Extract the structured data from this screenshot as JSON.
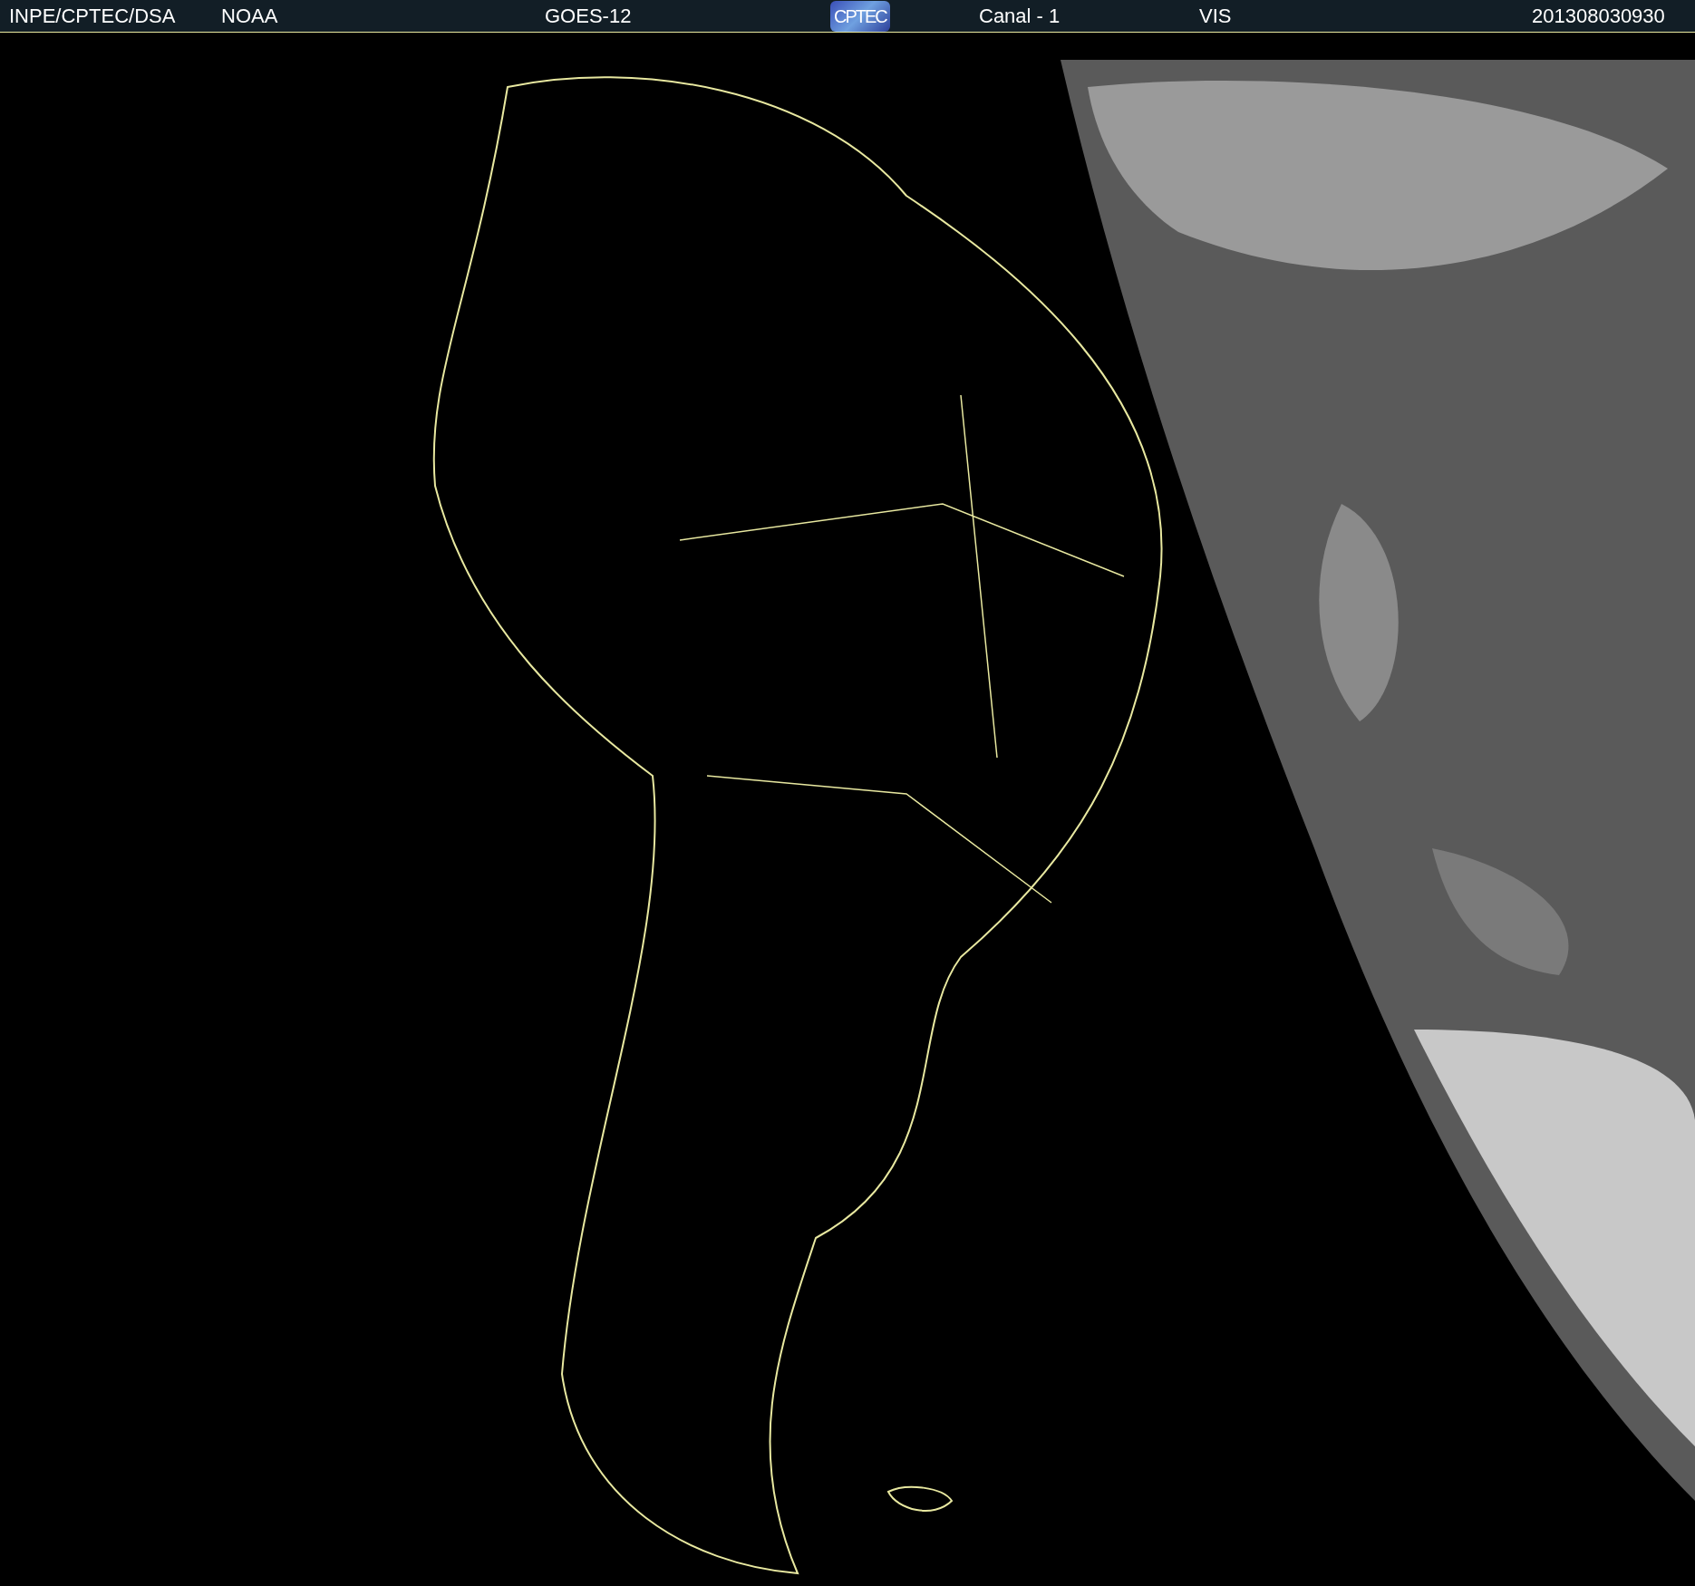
{
  "header": {
    "items": [
      {
        "kind": "text",
        "text": "INPE/CPTEC/DSA"
      },
      {
        "kind": "text",
        "text": "NOAA"
      },
      {
        "kind": "text",
        "text": "GOES-12"
      },
      {
        "kind": "logo",
        "text": "CPTEC"
      },
      {
        "kind": "text",
        "text": "Canal - 1"
      },
      {
        "kind": "text",
        "text": "VIS"
      },
      {
        "kind": "text",
        "text": "201308030930"
      }
    ]
  }
}
